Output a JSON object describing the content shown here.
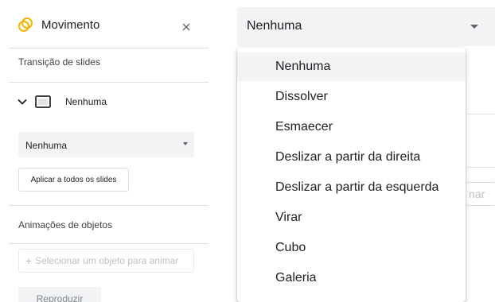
{
  "panel": {
    "title": "Movimento",
    "close_label": "×",
    "transition_section_label": "Transição de slides",
    "current_transition": "Nenhuma",
    "transition_select_value": "Nenhuma",
    "apply_all_label": "Aplicar a todos os slides",
    "object_section_label": "Animações de objetos",
    "select_object_plus": "+",
    "select_object_label": "Selecionar um objeto para animar",
    "play_label": "Reproduzir"
  },
  "zoom": {
    "select_value": "Nenhuma",
    "apply_partial_text": "nar",
    "menu_items": [
      {
        "label": "Nenhuma",
        "selected": true
      },
      {
        "label": "Dissolver",
        "selected": false
      },
      {
        "label": "Esmaecer",
        "selected": false
      },
      {
        "label": "Deslizar a partir da direita",
        "selected": false
      },
      {
        "label": "Deslizar a partir da esquerda",
        "selected": false
      },
      {
        "label": "Virar",
        "selected": false
      },
      {
        "label": "Cubo",
        "selected": false
      },
      {
        "label": "Galeria",
        "selected": false
      }
    ]
  },
  "icons": {
    "logo": "motion-logo-icon",
    "close": "close-icon",
    "chevron": "chevron-down-icon",
    "slide": "slide-icon",
    "dropdown": "dropdown-caret-icon"
  },
  "colors": {
    "logo_accent": "#f4b400",
    "select_bg": "#f1f3f4",
    "divider": "#e0e0e0",
    "text": "#202124",
    "muted_text": "#bdc1c6"
  }
}
